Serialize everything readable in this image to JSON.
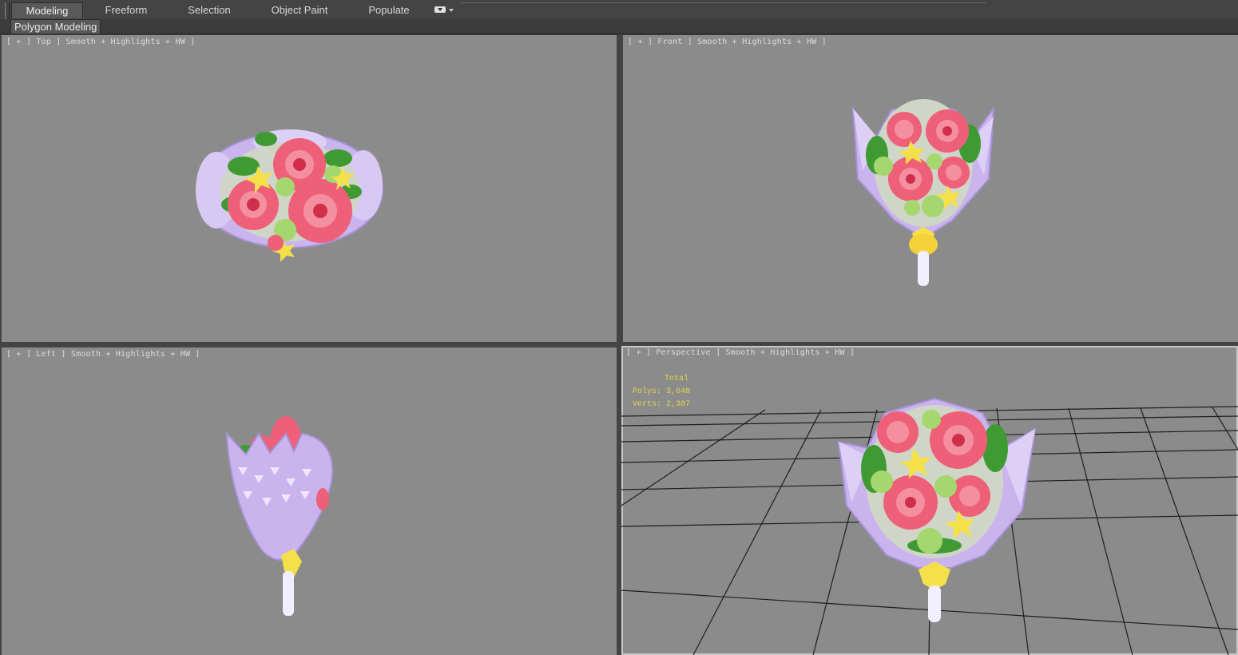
{
  "ribbon": {
    "tabs": [
      {
        "label": "Modeling",
        "active": true
      },
      {
        "label": "Freeform",
        "active": false
      },
      {
        "label": "Selection",
        "active": false
      },
      {
        "label": "Object Paint",
        "active": false
      },
      {
        "label": "Populate",
        "active": false
      }
    ],
    "panel_label": "Polygon Modeling"
  },
  "viewports": [
    {
      "label": "[ + ] Top ] Smooth + Highlights + HW ]"
    },
    {
      "label": "[ + ] Front ] Smooth + Highlights + HW ]"
    },
    {
      "label": "[ + ] Left ] Smooth + Highlights + HW ]"
    },
    {
      "label": "[ + ] Perspective ] Smooth + Highlights + HW ]"
    }
  ],
  "stats": {
    "title": "Total",
    "polys": "Polys: 3,048",
    "verts": "Verts: 2,387"
  },
  "colors": {
    "viewport_bg": "#8b8b8b",
    "ui_bg": "#444444",
    "stats_text": "#e6d34a",
    "wrap_lilac": "#c9b4ee",
    "rose": "#ee5f78",
    "leaf": "#3f9a34",
    "lily": "#f4e14a",
    "green_rose": "#a6d66e"
  }
}
